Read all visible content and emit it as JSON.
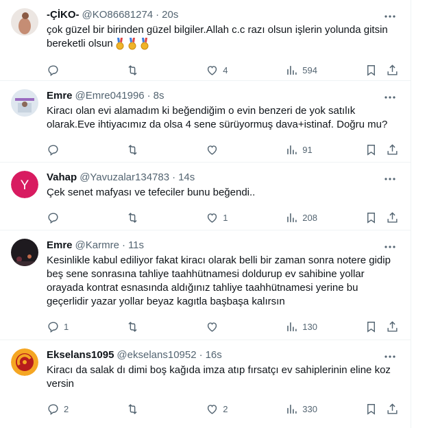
{
  "tweets": [
    {
      "name": "-ÇİKO-",
      "handle": "@KO86681274",
      "sep": "·",
      "time": "20s",
      "text": "çok güzel bir birinden güzel bilgiler.Allah c.c razı olsun işlerin yolunda gitsin bereketli olsun",
      "reply_count": "",
      "retweet_count": "",
      "like_count": "4",
      "view_count": "594",
      "avatar_color": "#d9b4a8"
    },
    {
      "name": "Emre",
      "handle": "@Emre041996",
      "sep": "·",
      "time": "8s",
      "text": "Kiracı olan evi alamadım ki beğendiğim o evin benzeri de yok satılık olarak.Eve ihtiyacımız da olsa 4 sene sürüyormuş dava+istinaf. Doğru mu?",
      "reply_count": "",
      "retweet_count": "",
      "like_count": "",
      "view_count": "91",
      "avatar_color": "#b9c9d9"
    },
    {
      "name": "Vahap",
      "handle": "@Yavuzalar134783",
      "sep": "·",
      "time": "14s",
      "text": "Çek senet mafyası ve tefeciler bunu beğendi..",
      "reply_count": "",
      "retweet_count": "",
      "like_count": "1",
      "view_count": "208",
      "avatar_letter": "Y",
      "avatar_color": "#d81b60"
    },
    {
      "name": "Emre",
      "handle": "@Karmre",
      "sep": "·",
      "time": "11s",
      "text": "Kesinlikle kabul ediliyor fakat kiracı olarak belli bir zaman sonra notere gidip beş sene sonrasına tahliye taahhütnamesi doldurup ev sahibine yollar orayada kontrat esnasında aldığınız tahliye taahhütnamesi yerine bu geçerlidir yazar yollar beyaz kagıtla başbaşa kalırsın",
      "reply_count": "1",
      "retweet_count": "",
      "like_count": "",
      "view_count": "130",
      "avatar_color": "#2b1f26"
    },
    {
      "name": "Ekselans1095",
      "handle": "@ekselans10952",
      "sep": "·",
      "time": "16s",
      "text": "Kiracı da salak dı dimi boş kağıda imza atıp fırsatçı ev sahiplerinin eline koz versin",
      "reply_count": "2",
      "retweet_count": "",
      "like_count": "2",
      "view_count": "330",
      "avatar_color": "#f5a623"
    }
  ],
  "colors": {
    "text": "#0f1419",
    "secondary": "#536471",
    "border": "#eff3f4"
  },
  "icons": [
    "reply-icon",
    "retweet-icon",
    "like-icon",
    "views-icon",
    "bookmark-icon",
    "share-icon",
    "more-icon",
    "medal-icon"
  ]
}
